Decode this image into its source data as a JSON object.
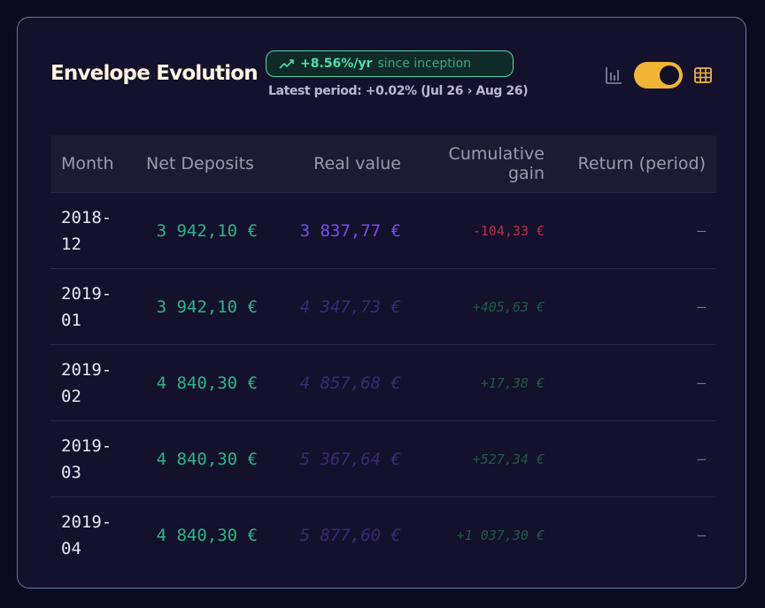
{
  "card": {
    "title": "Envelope Evolution",
    "badge": {
      "rate": "+8.56%/yr",
      "since": "since inception"
    },
    "latest_period": "Latest period: +0.02% (Jul 26 › Aug 26)"
  },
  "controls": {
    "chart_icon": "bar-chart-icon",
    "table_icon": "table-icon",
    "toggle_on": true
  },
  "table": {
    "headers": [
      "Month",
      "Net Deposits",
      "Real value",
      "Cumulative gain",
      "Return (period)"
    ],
    "rows": [
      {
        "month": "2018-\n12",
        "deposits": "3 942,10 €",
        "real": "3 837,77 €",
        "gain": "-104,33 €",
        "ret": "—"
      },
      {
        "month": "2019-\n01",
        "deposits": "3 942,10 €",
        "real": "4 347,73 €",
        "gain": "+405,63 €",
        "ret": "—"
      },
      {
        "month": "2019-\n02",
        "deposits": "4 840,30 €",
        "real": "4 857,68 €",
        "gain": "+17,38 €",
        "ret": "—"
      },
      {
        "month": "2019-\n03",
        "deposits": "4 840,30 €",
        "real": "5 367,64 €",
        "gain": "+527,34 €",
        "ret": "—"
      },
      {
        "month": "2019-\n04",
        "deposits": "4 840,30 €",
        "real": "5 877,60 €",
        "gain": "+1 037,30 €",
        "ret": "—"
      }
    ]
  },
  "colors": {
    "accent_yellow": "#f0b536",
    "deposit_green": "#2db588",
    "real_purple": "#7b4cf0",
    "negative_red": "#c42a48"
  }
}
